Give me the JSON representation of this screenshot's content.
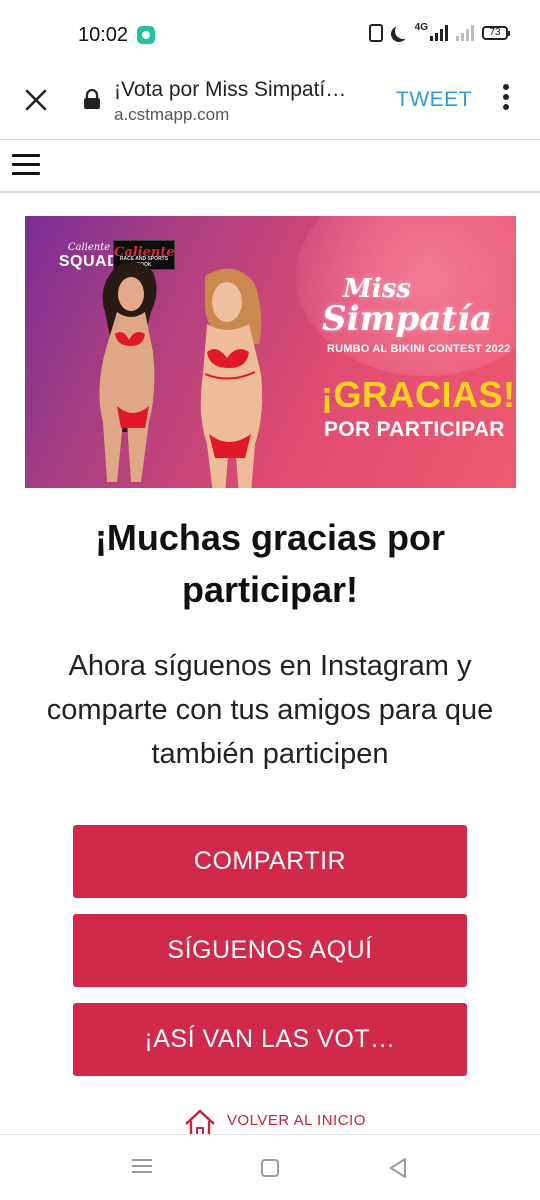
{
  "status_bar": {
    "time": "10:02",
    "network": "4G",
    "battery": "73"
  },
  "browser": {
    "page_title": "¡Vota por Miss Simpatí…",
    "url": "a.cstmapp.com",
    "tweet_label": "TWEET"
  },
  "banner": {
    "squad_logo_line1": "Caliente",
    "squad_logo_line2": "SQUAD",
    "caliente_logo": "Caliente",
    "caliente_logo_sub": "RACE AND SPORTS BOOK",
    "miss_line1": "Miss",
    "miss_line2": "Simpatía",
    "rumbo": "RUMBO AL BIKINI CONTEST 2022",
    "gracias": "¡GRACIAS!",
    "por_participar": "POR PARTICIPAR"
  },
  "content": {
    "heading": "¡Muchas gracias por participar!",
    "subtext": "Ahora síguenos en Instagram y comparte con tus amigos para que también participen"
  },
  "buttons": {
    "compartir": "COMPARTIR",
    "siguenos": "SÍGUENOS AQUÍ",
    "votos": "¡ASÍ VAN LAS VOT…"
  },
  "home_link": {
    "label": "VOLVER AL INICIO"
  },
  "colors": {
    "cta": "#d0294a",
    "tweet": "#2e9bd6",
    "gracias": "#ffd21f"
  }
}
